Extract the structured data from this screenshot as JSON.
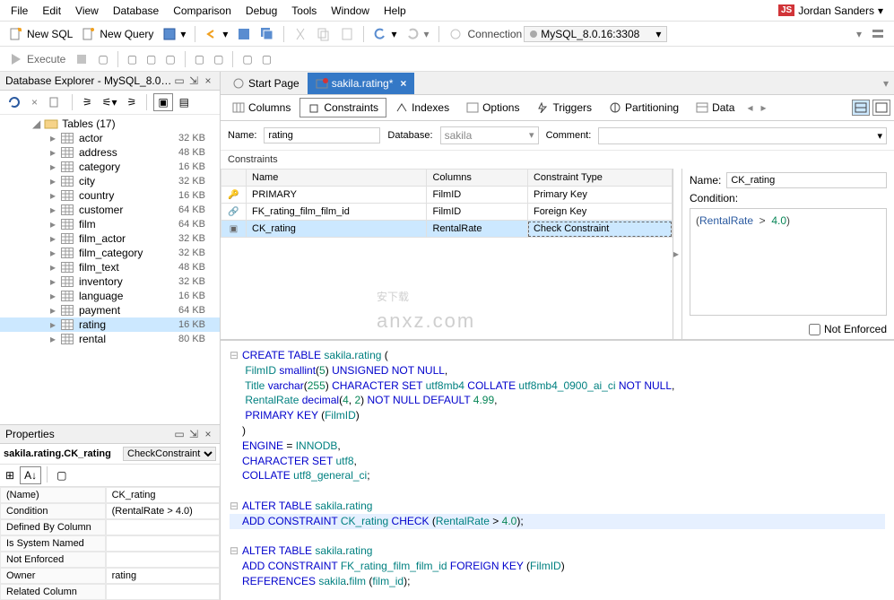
{
  "menubar": [
    "File",
    "Edit",
    "View",
    "Database",
    "Comparison",
    "Debug",
    "Tools",
    "Window",
    "Help"
  ],
  "user": {
    "badge": "JS",
    "name": "Jordan Sanders"
  },
  "toolbar1": {
    "newSql": "New SQL",
    "newQuery": "New Query",
    "connection_label": "Connection",
    "connection_value": "MySQL_8.0.16:3308"
  },
  "toolbar2": {
    "execute": "Execute"
  },
  "dbExplorer": {
    "title": "Database Explorer - MySQL_8.0.1...",
    "groupLabel": "Tables (17)",
    "tables": [
      {
        "name": "actor",
        "size": "32 KB"
      },
      {
        "name": "address",
        "size": "48 KB"
      },
      {
        "name": "category",
        "size": "16 KB"
      },
      {
        "name": "city",
        "size": "32 KB"
      },
      {
        "name": "country",
        "size": "16 KB"
      },
      {
        "name": "customer",
        "size": "64 KB"
      },
      {
        "name": "film",
        "size": "64 KB"
      },
      {
        "name": "film_actor",
        "size": "32 KB"
      },
      {
        "name": "film_category",
        "size": "32 KB"
      },
      {
        "name": "film_text",
        "size": "48 KB"
      },
      {
        "name": "inventory",
        "size": "32 KB"
      },
      {
        "name": "language",
        "size": "16 KB"
      },
      {
        "name": "payment",
        "size": "64 KB"
      },
      {
        "name": "rating",
        "size": "16 KB",
        "selected": true
      },
      {
        "name": "rental",
        "size": "80 KB"
      }
    ]
  },
  "properties": {
    "title": "Properties",
    "entity": "sakila.rating.CK_rating",
    "type": "CheckConstraint",
    "rows": [
      {
        "name": "(Name)",
        "value": "CK_rating"
      },
      {
        "name": "Condition",
        "value": "(RentalRate > 4.0)"
      },
      {
        "name": "Defined By Column",
        "value": ""
      },
      {
        "name": "Is System Named",
        "value": ""
      },
      {
        "name": "Not Enforced",
        "value": ""
      },
      {
        "name": "Owner",
        "value": "rating"
      },
      {
        "name": "Related Column",
        "value": ""
      }
    ]
  },
  "tabs": {
    "startPage": "Start Page",
    "active": "sakila.rating*"
  },
  "designerTabs": [
    "Columns",
    "Constraints",
    "Indexes",
    "Options",
    "Triggers",
    "Partitioning",
    "Data"
  ],
  "form": {
    "nameLabel": "Name:",
    "nameValue": "rating",
    "dbLabel": "Database:",
    "dbValue": "sakila",
    "commentLabel": "Comment:",
    "sectionLabel": "Constraints"
  },
  "consTable": {
    "headers": [
      "Name",
      "Columns",
      "Constraint Type"
    ],
    "rows": [
      {
        "icon": "key",
        "name": "PRIMARY",
        "cols": "FilmID",
        "type": "Primary Key"
      },
      {
        "icon": "link",
        "name": "FK_rating_film_film_id",
        "cols": "FilmID",
        "type": "Foreign Key"
      },
      {
        "icon": "check",
        "name": "CK_rating",
        "cols": "RentalRate",
        "type": "Check Constraint",
        "selected": true
      }
    ]
  },
  "consSide": {
    "nameLabel": "Name:",
    "nameValue": "CK_rating",
    "conditionLabel": "Condition:",
    "conditionRaw": "(RentalRate > 4.0)",
    "notEnforced": "Not Enforced"
  },
  "sql": {
    "lines": [
      "CREATE TABLE sakila.rating (",
      "  FilmID smallint(5) UNSIGNED NOT NULL,",
      "  Title varchar(255) CHARACTER SET utf8mb4 COLLATE utf8mb4_0900_ai_ci NOT NULL,",
      "  RentalRate decimal(4, 2) NOT NULL DEFAULT 4.99,",
      "  PRIMARY KEY (FilmID)",
      ")",
      "ENGINE = INNODB,",
      "CHARACTER SET utf8,",
      "COLLATE utf8_general_ci;",
      "",
      "ALTER TABLE sakila.rating",
      "ADD CONSTRAINT CK_rating CHECK (RentalRate > 4.0);",
      "",
      "ALTER TABLE sakila.rating",
      "ADD CONSTRAINT FK_rating_film_film_id FOREIGN KEY (FilmID)",
      "REFERENCES sakila.film (film_id);"
    ],
    "highlight": 11
  },
  "watermark": {
    "main": "安下载",
    "sub": "anxz.com"
  }
}
